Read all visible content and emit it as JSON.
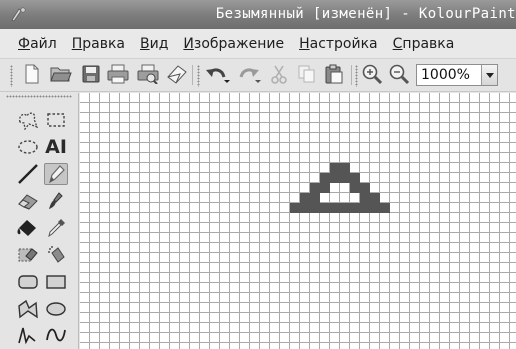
{
  "window": {
    "title": "Безымянный [изменён] - KolourPaint"
  },
  "menu": {
    "items": [
      {
        "mnemonic": "Ф",
        "rest": "айл"
      },
      {
        "mnemonic": "П",
        "rest": "равка"
      },
      {
        "mnemonic": "В",
        "rest": "ид"
      },
      {
        "mnemonic": "И",
        "rest": "зображение"
      },
      {
        "mnemonic": "Н",
        "rest": "астройка"
      },
      {
        "mnemonic": "С",
        "rest": "правка"
      }
    ]
  },
  "toolbar": {
    "buttons": [
      "new-icon",
      "open-icon",
      "save-icon",
      "print-icon",
      "print-preview-icon",
      "mail-icon",
      "undo-icon",
      "redo-icon",
      "cut-icon",
      "copy-icon",
      "paste-icon",
      "zoom-in-icon",
      "zoom-out-icon"
    ],
    "zoom": "1000%"
  },
  "tools": {
    "text_tool_glyph": "AI",
    "active": "pen-tool"
  },
  "canvas": {
    "pixel_color": "#555555",
    "drawing_rows": [
      "....##....",
      "...####...",
      "..##..##..",
      ".##....##.",
      "##########"
    ]
  }
}
